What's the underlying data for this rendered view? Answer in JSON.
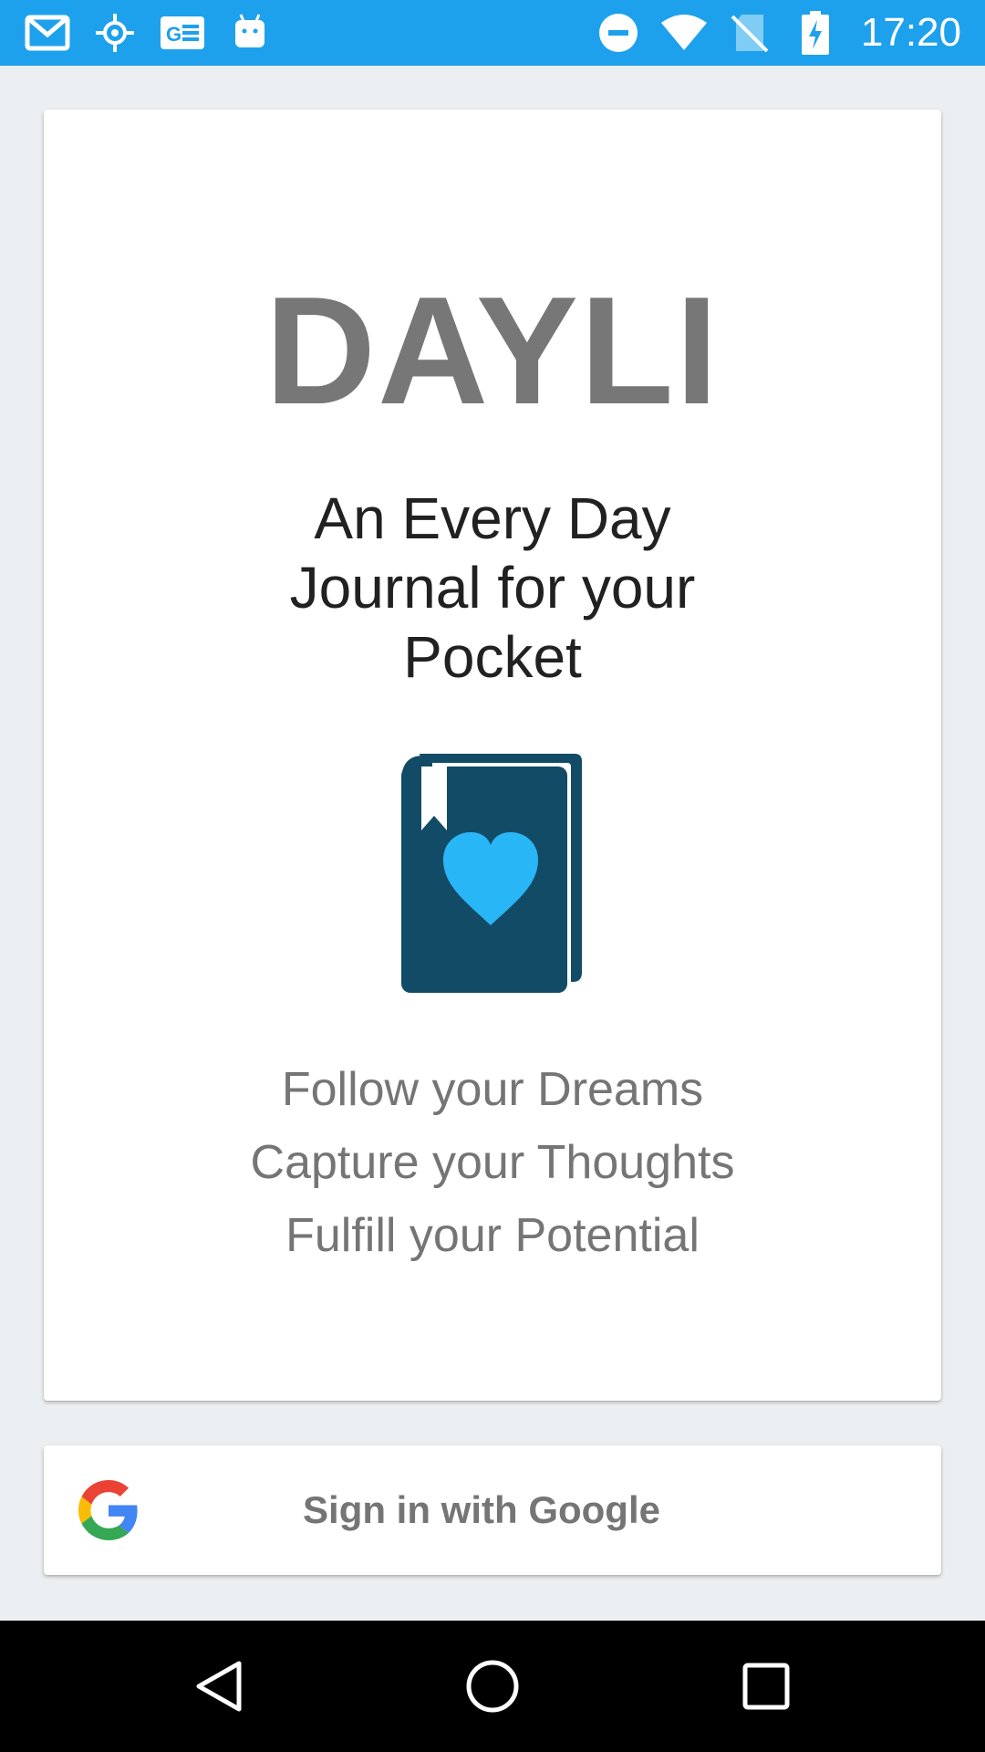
{
  "status_bar": {
    "time": "17:20",
    "left_icons": [
      "gmail-icon",
      "gps-icon",
      "news-icon",
      "android-icon"
    ],
    "right_icons": [
      "do-not-disturb-icon",
      "wifi-icon",
      "no-sim-icon",
      "battery-charging-icon"
    ],
    "color": "#1da1ec"
  },
  "card": {
    "title": "DAYLI",
    "tagline": "An Every Day Journal for your Pocket",
    "icon": "journal-heart-icon",
    "mottos": [
      "Follow your Dreams",
      "Capture your Thoughts",
      "Fulfill your Potential"
    ]
  },
  "signin": {
    "label": "Sign in with Google",
    "icon": "google-logo-icon"
  },
  "nav": {
    "buttons": [
      "back-icon",
      "home-icon",
      "recents-icon"
    ]
  },
  "colors": {
    "accent": "#1da1ec",
    "book": "#124b66",
    "heart": "#29b6f6",
    "title": "#777777"
  }
}
